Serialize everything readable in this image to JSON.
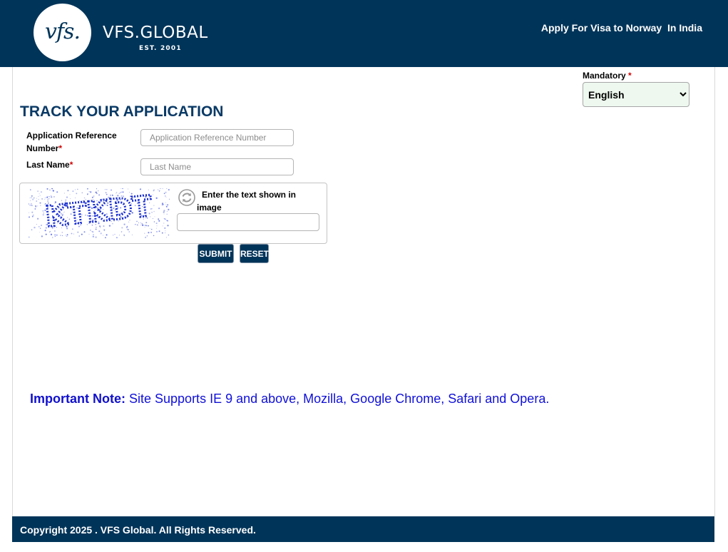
{
  "header": {
    "logo_mark": "vfs.",
    "brand_name": "VFS.GLOBAL",
    "brand_est": "EST. 2001",
    "title": "Apply For Visa to Norway  In India"
  },
  "language": {
    "label": "Mandatory",
    "required_marker": "*",
    "selected": "English"
  },
  "form": {
    "title": "TRACK YOUR APPLICATION",
    "reference_label": "Application Reference Number",
    "reference_placeholder": "Application Reference Number",
    "lastname_label": "Last Name",
    "lastname_placeholder": "Last Name",
    "required_marker": "*",
    "captcha_text": "KTKDT",
    "captcha_label": "Enter the text shown in image",
    "captcha_value": "",
    "submit_label": "SUBMIT",
    "reset_label": "RESET"
  },
  "note": {
    "label": "Important Note:",
    "text": " Site Supports IE 9 and above, Mozilla, Google Chrome, Safari and Opera."
  },
  "footer": {
    "copyright": "Copyright 2025 . VFS Global. All Rights Reserved."
  },
  "colors": {
    "brand_navy": "#003459",
    "title_blue": "#0a3a66",
    "note_blue": "#1010d8",
    "required_red": "#d20000",
    "captcha_ink": "#1a2fd0"
  },
  "icons": {
    "refresh": "refresh-icon"
  }
}
